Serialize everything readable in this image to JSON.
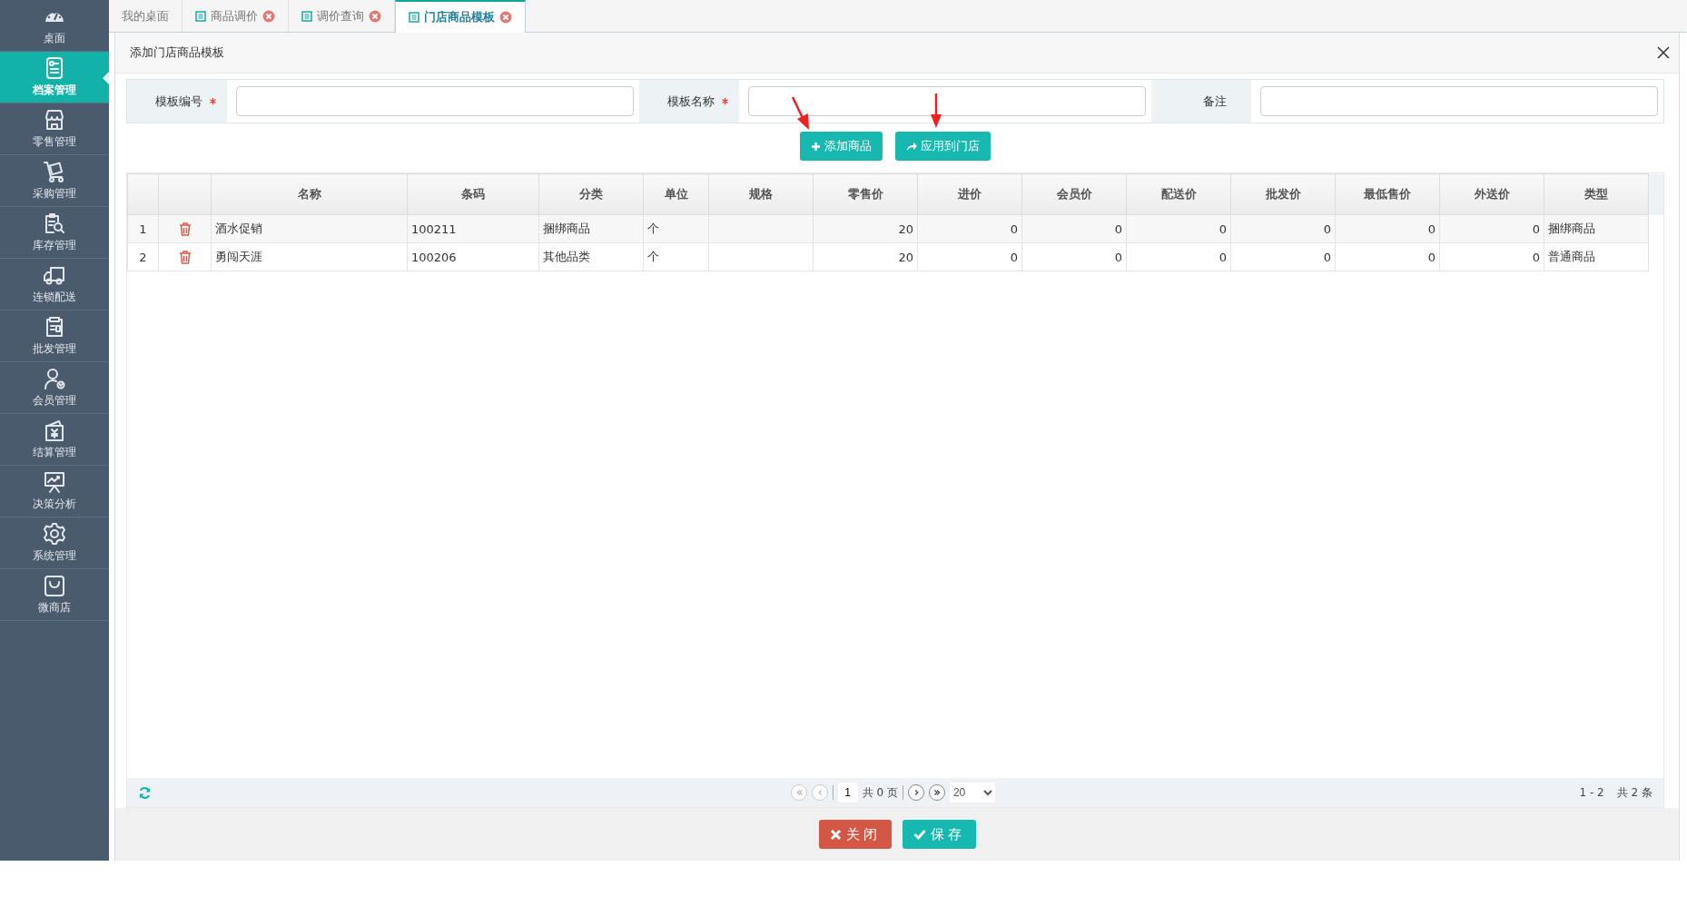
{
  "sidebar": {
    "items": [
      {
        "label": "桌面",
        "selected": false
      },
      {
        "label": "档案管理",
        "selected": true
      },
      {
        "label": "零售管理",
        "selected": false
      },
      {
        "label": "采购管理",
        "selected": false
      },
      {
        "label": "库存管理",
        "selected": false
      },
      {
        "label": "连锁配送",
        "selected": false
      },
      {
        "label": "批发管理",
        "selected": false
      },
      {
        "label": "会员管理",
        "selected": false
      },
      {
        "label": "结算管理",
        "selected": false
      },
      {
        "label": "决策分析",
        "selected": false
      },
      {
        "label": "系统管理",
        "selected": false
      },
      {
        "label": "微商店",
        "selected": false
      }
    ]
  },
  "tabs": [
    {
      "label": "我的桌面",
      "selected": false,
      "closable": false
    },
    {
      "label": "商品调价",
      "selected": false,
      "closable": true
    },
    {
      "label": "调价查询",
      "selected": false,
      "closable": true
    },
    {
      "label": "门店商品模板",
      "selected": true,
      "closable": true
    }
  ],
  "dialog": {
    "title": "添加门店商品模板",
    "fields": [
      {
        "label": "模板编号",
        "required": true
      },
      {
        "label": "模板名称",
        "required": true
      },
      {
        "label": "备注",
        "required": false
      }
    ],
    "actions": [
      {
        "label": "添加商品",
        "kind": "add"
      },
      {
        "label": "应用到门店",
        "kind": "apply"
      }
    ],
    "table": {
      "columns": [
        {
          "label": "名称",
          "kind": "text"
        },
        {
          "label": "条码",
          "kind": "text"
        },
        {
          "label": "分类",
          "kind": "text"
        },
        {
          "label": "单位",
          "kind": "text"
        },
        {
          "label": "规格",
          "kind": "text"
        },
        {
          "label": "零售价",
          "kind": "number"
        },
        {
          "label": "进价",
          "kind": "number"
        },
        {
          "label": "会员价",
          "kind": "number"
        },
        {
          "label": "配送价",
          "kind": "number"
        },
        {
          "label": "批发价",
          "kind": "number"
        },
        {
          "label": "最低售价",
          "kind": "number"
        },
        {
          "label": "外送价",
          "kind": "number"
        },
        {
          "label": "类型",
          "kind": "text"
        }
      ],
      "rows": [
        {
          "number": "1",
          "cells": [
            "酒水促销",
            "100211",
            "捆绑商品",
            "个",
            "",
            "20",
            "0",
            "0",
            "0",
            "0",
            "0",
            "0",
            "捆绑商品"
          ]
        },
        {
          "number": "2",
          "cells": [
            "勇闯天涯",
            "100206",
            "其他品类",
            "个",
            "",
            "20",
            "0",
            "0",
            "0",
            "0",
            "0",
            "0",
            "普通商品"
          ]
        }
      ]
    },
    "pager": {
      "nav": [
        {
          "kind": "first",
          "disabled": true
        },
        {
          "kind": "prev",
          "disabled": true
        },
        {
          "kind": "next",
          "disabled": false
        },
        {
          "kind": "last",
          "disabled": false
        }
      ],
      "page": "1",
      "pages": "共 0 页",
      "page_size": "20",
      "range": "1 - 2",
      "total": "共 2 条"
    },
    "buttons": [
      {
        "label": "关闭",
        "kind": "close"
      },
      {
        "label": "保存",
        "kind": "save"
      }
    ]
  }
}
